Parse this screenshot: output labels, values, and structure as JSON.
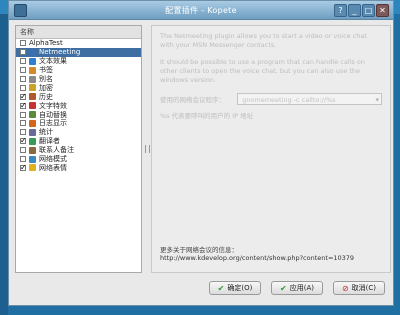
{
  "window": {
    "title": "配置插件 - Kopete"
  },
  "sidebar": {
    "header": "名称",
    "items": [
      {
        "label": "AlphaTest",
        "checked": false,
        "icon": "none"
      },
      {
        "label": "Netmeeting",
        "checked": false,
        "icon": "netmeeting-icon",
        "selected": true
      },
      {
        "label": "文本效果",
        "checked": false,
        "icon": "text-effect-icon"
      },
      {
        "label": "书签",
        "checked": false,
        "icon": "bookmark-icon"
      },
      {
        "label": "别名",
        "checked": false,
        "icon": "alias-icon"
      },
      {
        "label": "加密",
        "checked": false,
        "icon": "lock-icon"
      },
      {
        "label": "历史",
        "checked": true,
        "icon": "history-icon"
      },
      {
        "label": "文字特效",
        "checked": true,
        "icon": "effect-icon"
      },
      {
        "label": "自动替换",
        "checked": false,
        "icon": "replace-icon"
      },
      {
        "label": "日志显示",
        "checked": false,
        "icon": "log-icon"
      },
      {
        "label": "统计",
        "checked": false,
        "icon": "stats-icon"
      },
      {
        "label": "翻译者",
        "checked": true,
        "icon": "translator-icon"
      },
      {
        "label": "联系人备注",
        "checked": false,
        "icon": "notes-icon"
      },
      {
        "label": "网络模式",
        "checked": false,
        "icon": "network-icon"
      },
      {
        "label": "网络表情",
        "checked": true,
        "icon": "smiley-icon"
      }
    ]
  },
  "content": {
    "para1": "The Netmeeting plugin allows you to start a video or voice chat with your MSN Messenger contacts.",
    "para2": "It should be possible to use a program that can handle calls on other clients to open the voice chat, but you can also use the windows version.",
    "program_label": "使用的网络会议程序：",
    "program_value": "gnomemeeting -c callto://%s",
    "hint": "%s 代表要呼叫的用户的 IP 地址",
    "footer_title": "更多关于网络会议的信息：",
    "footer_url": "http://www.kdevelop.org/content/show.php?content=10379"
  },
  "buttons": {
    "ok": "确定(O)",
    "apply": "应用(A)",
    "cancel": "取消(C)"
  },
  "colors": {
    "selection": "#3f6ea2",
    "titlebar": "#7ea9cc"
  }
}
